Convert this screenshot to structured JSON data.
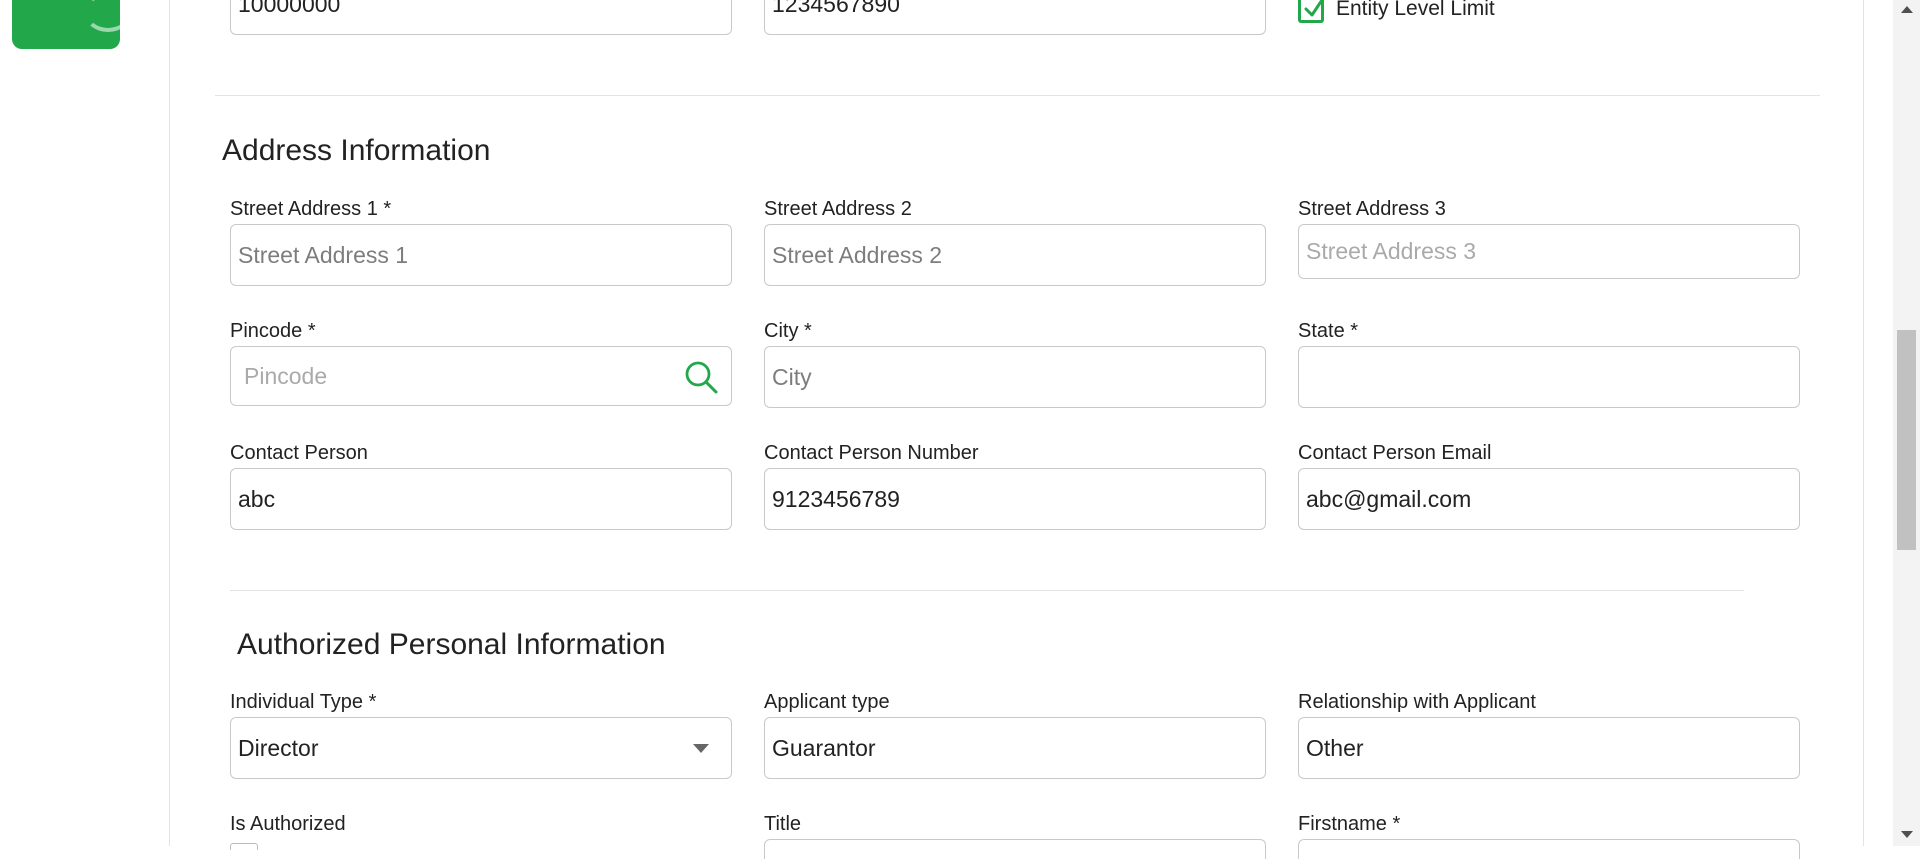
{
  "top_row": {
    "field1_value": "10000000",
    "field2_value": "1234567890",
    "entity_level_limit_label": "Entity Level Limit",
    "entity_level_limit_checked": true
  },
  "address": {
    "title": "Address Information",
    "street1": {
      "label": "Street Address 1 *",
      "placeholder": "Street Address 1"
    },
    "street2": {
      "label": "Street Address 2",
      "placeholder": "Street Address 2"
    },
    "street3": {
      "label": "Street Address 3",
      "placeholder": "Street Address 3"
    },
    "pincode": {
      "label": "Pincode *",
      "placeholder": "Pincode"
    },
    "city": {
      "label": "City *",
      "placeholder": "City"
    },
    "state": {
      "label": "State *",
      "value": ""
    },
    "contact_person": {
      "label": "Contact Person",
      "value": "abc"
    },
    "contact_number": {
      "label": "Contact Person Number",
      "value": "9123456789"
    },
    "contact_email": {
      "label": "Contact Person Email",
      "value": "abc@gmail.com"
    }
  },
  "authorized": {
    "title": "Authorized Personal Information",
    "individual_type": {
      "label": "Individual Type *",
      "value": "Director"
    },
    "applicant_type": {
      "label": "Applicant type",
      "value": "Guarantor"
    },
    "relationship": {
      "label": "Relationship with Applicant",
      "value": "Other"
    },
    "is_authorized": {
      "label": "Is Authorized"
    },
    "title_field": {
      "label": "Title"
    },
    "firstname": {
      "label": "Firstname *"
    }
  },
  "icons": [
    "refresh-icon",
    "check-icon",
    "search-icon",
    "chevron-down-icon"
  ],
  "colors": {
    "accent": "#22a84a",
    "border": "#c9c9c9",
    "divider": "#e3e3e3"
  }
}
